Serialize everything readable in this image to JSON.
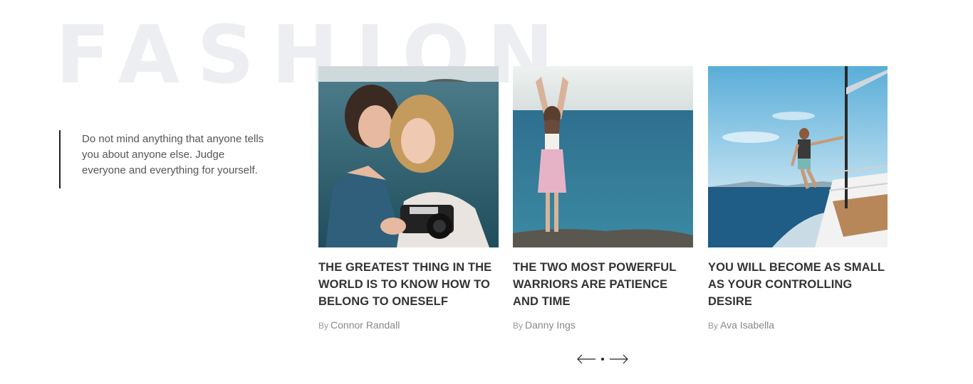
{
  "section": {
    "background_title": "FASHION"
  },
  "quote": {
    "text": "Do not mind anything that anyone tells you about anyone else. Judge everyone and everything for yourself."
  },
  "posts": [
    {
      "title": "THE GREATEST THING IN THE WORLD IS TO KNOW HOW TO BELONG TO ONESELF",
      "by_prefix": "By",
      "author": "Connor Randall",
      "image": "two-women-with-camera-by-sea"
    },
    {
      "title": "THE TWO MOST POWERFUL WARRIORS ARE PATIENCE AND TIME",
      "by_prefix": "By",
      "author": "Danny Ings",
      "image": "woman-arms-raised-facing-sea"
    },
    {
      "title": "YOU WILL BECOME AS SMALL AS YOUR CONTROLLING DESIRE",
      "by_prefix": "By",
      "author": "Ava Isabella",
      "image": "man-on-sailboat-rail"
    }
  ],
  "pager": {
    "prev_icon": "arrow-left-icon",
    "next_icon": "arrow-right-icon"
  },
  "colors": {
    "background_title": "#eceef1",
    "text_dark": "#333333",
    "text_muted": "#888888",
    "rule": "#222222"
  }
}
